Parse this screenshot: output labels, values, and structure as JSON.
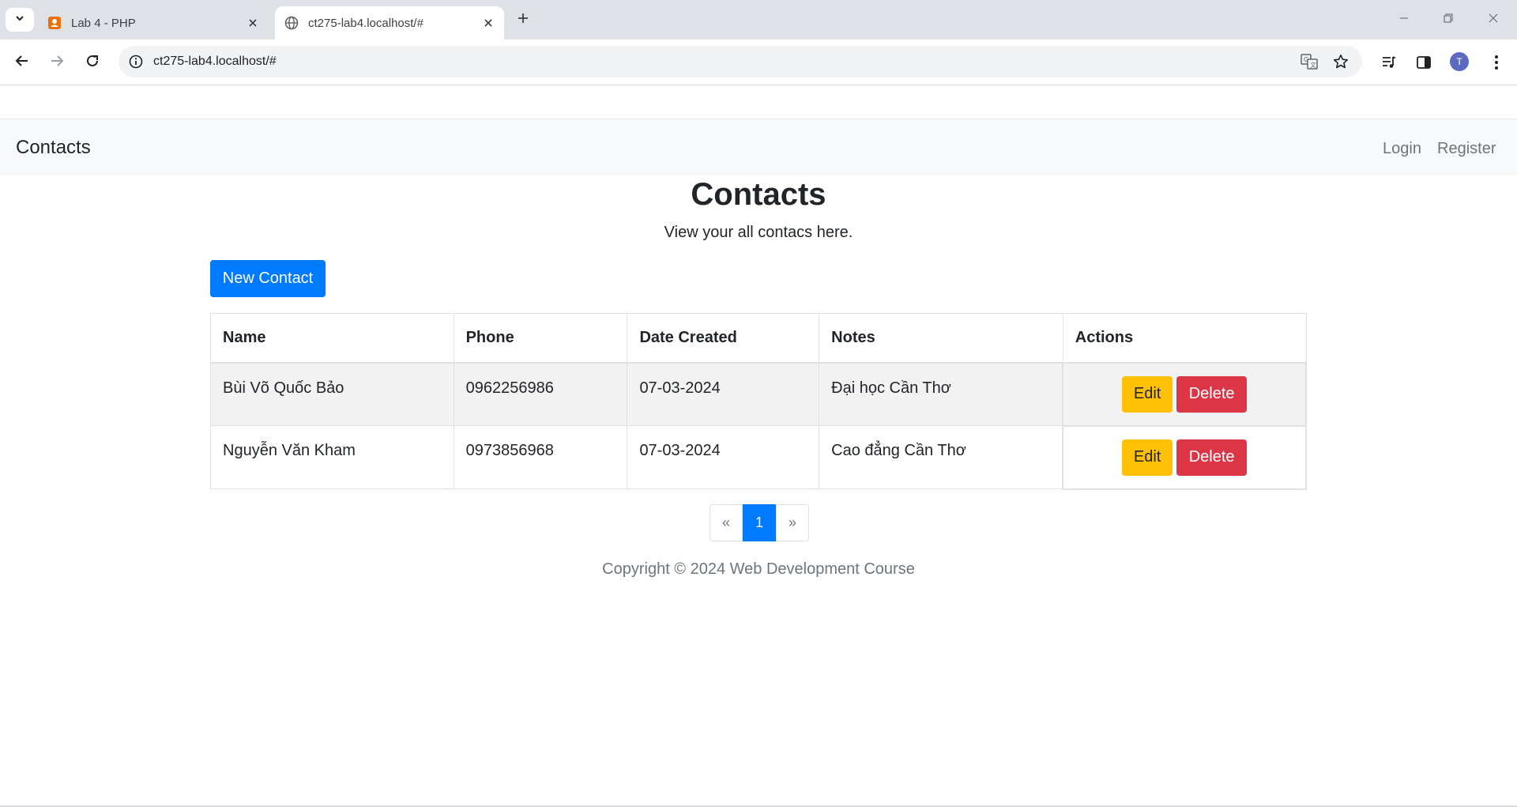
{
  "browser": {
    "tabs": [
      {
        "title": "Lab 4 - PHP",
        "active": false
      },
      {
        "title": "ct275-lab4.localhost/#",
        "active": true
      }
    ],
    "url": "ct275-lab4.localhost/#",
    "profile_initial": "T"
  },
  "navbar": {
    "brand": "Contacts",
    "login": "Login",
    "register": "Register"
  },
  "main": {
    "title": "Contacts",
    "subtitle": "View your all contacs here.",
    "new_contact_label": "New Contact"
  },
  "table": {
    "headers": [
      "Name",
      "Phone",
      "Date Created",
      "Notes",
      "Actions"
    ],
    "rows": [
      {
        "name": "Bùi Võ Quốc Bảo",
        "phone": "0962256986",
        "date": "07-03-2024",
        "notes": "Đại học Cần Thơ"
      },
      {
        "name": "Nguyễn Văn Kham",
        "phone": "0973856968",
        "date": "07-03-2024",
        "notes": "Cao đẳng Cần Thơ"
      }
    ],
    "edit_label": "Edit",
    "delete_label": "Delete"
  },
  "pagination": {
    "prev": "«",
    "current": "1",
    "next": "»"
  },
  "footer": {
    "text": "Copyright © 2024 Web Development Course"
  },
  "colors": {
    "primary": "#007bff",
    "warning": "#ffc107",
    "danger": "#dc3545"
  }
}
